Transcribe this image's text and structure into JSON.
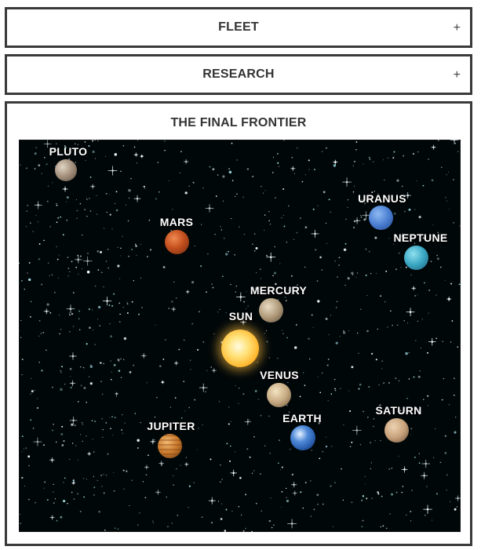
{
  "panels": {
    "fleet": {
      "title": "FLEET",
      "toggle": "+"
    },
    "research": {
      "title": "RESEARCH",
      "toggle": "+"
    },
    "frontier": {
      "title": "THE FINAL FRONTIER"
    }
  },
  "bodies": {
    "pluto": {
      "label": "PLUTO",
      "color": "#9a8a7a",
      "icon": "pluto-icon"
    },
    "mars": {
      "label": "MARS",
      "color": "#c0501f",
      "icon": "mars-icon"
    },
    "uranus": {
      "label": "URANUS",
      "color": "#4f86d6",
      "icon": "uranus-icon"
    },
    "neptune": {
      "label": "NEPTUNE",
      "color": "#3aa9c4",
      "icon": "neptune-icon"
    },
    "mercury": {
      "label": "MERCURY",
      "color": "#b8a282",
      "icon": "mercury-icon"
    },
    "sun": {
      "label": "SUN",
      "color": "#ffcc33",
      "icon": "sun-icon"
    },
    "venus": {
      "label": "VENUS",
      "color": "#c9b08a",
      "icon": "venus-icon"
    },
    "earth": {
      "label": "EARTH",
      "color": "#3d78c9",
      "icon": "earth-icon"
    },
    "jupiter": {
      "label": "JUPITER",
      "color": "#c8792c",
      "icon": "jupiter-icon"
    },
    "saturn": {
      "label": "SATURN",
      "color": "#c8a580",
      "icon": "saturn-icon"
    }
  }
}
